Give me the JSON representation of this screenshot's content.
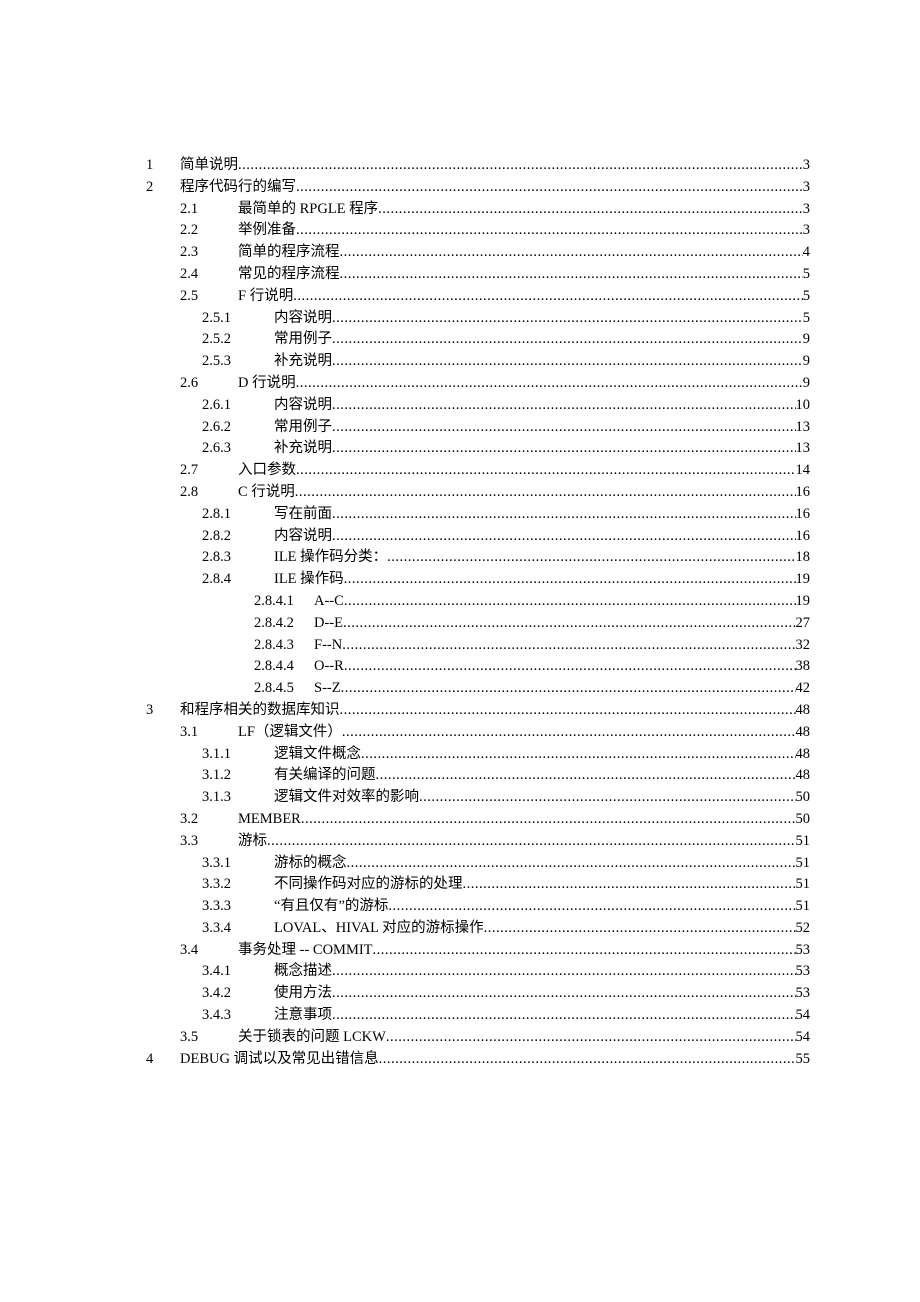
{
  "toc": [
    {
      "level": 1,
      "num": "1",
      "title": "简单说明",
      "page": "3"
    },
    {
      "level": 1,
      "num": "2",
      "title": "程序代码行的编写",
      "page": "3"
    },
    {
      "level": 2,
      "num": "2.1",
      "title": "最简单的 RPGLE 程序",
      "page": "3"
    },
    {
      "level": 2,
      "num": "2.2",
      "title": "举例准备",
      "page": "3"
    },
    {
      "level": 2,
      "num": "2.3",
      "title": "简单的程序流程",
      "page": "4"
    },
    {
      "level": 2,
      "num": "2.4",
      "title": "常见的程序流程",
      "page": "5"
    },
    {
      "level": 2,
      "num": "2.5",
      "title": "F 行说明 ",
      "page": "5"
    },
    {
      "level": 3,
      "num": "2.5.1",
      "title": "内容说明",
      "page": "5"
    },
    {
      "level": 3,
      "num": "2.5.2",
      "title": "常用例子",
      "page": "9"
    },
    {
      "level": 3,
      "num": "2.5.3",
      "title": "补充说明",
      "page": "9"
    },
    {
      "level": 2,
      "num": "2.6",
      "title": "D 行说明",
      "page": "9"
    },
    {
      "level": 3,
      "num": "2.6.1",
      "title": "内容说明",
      "page": "10"
    },
    {
      "level": 3,
      "num": "2.6.2",
      "title": "常用例子",
      "page": "13"
    },
    {
      "level": 3,
      "num": "2.6.3",
      "title": "补充说明",
      "page": "13"
    },
    {
      "level": 2,
      "num": "2.7",
      "title": "入口参数",
      "page": "14"
    },
    {
      "level": 2,
      "num": "2.8",
      "title": "C 行说明",
      "page": "16"
    },
    {
      "level": 3,
      "num": "2.8.1",
      "title": "写在前面",
      "page": "16"
    },
    {
      "level": 3,
      "num": "2.8.2",
      "title": "内容说明",
      "page": "16"
    },
    {
      "level": 3,
      "num": "2.8.3",
      "title": "ILE 操作码分类： ",
      "page": "18"
    },
    {
      "level": 3,
      "num": "2.8.4",
      "title": "ILE 操作码 ",
      "page": "19"
    },
    {
      "level": 4,
      "num": "2.8.4.1",
      "title": "A--C ",
      "page": "19"
    },
    {
      "level": 4,
      "num": "2.8.4.2",
      "title": "D--E",
      "page": "27"
    },
    {
      "level": 4,
      "num": "2.8.4.3",
      "title": "F--N",
      "page": "32"
    },
    {
      "level": 4,
      "num": "2.8.4.4",
      "title": "O--R ",
      "page": "38"
    },
    {
      "level": 4,
      "num": "2.8.4.5",
      "title": "S--Z ",
      "page": "42"
    },
    {
      "level": 1,
      "num": "3",
      "title": "和程序相关的数据库知识",
      "page": "48"
    },
    {
      "level": 2,
      "num": "3.1",
      "title": "LF（逻辑文件）",
      "page": "48"
    },
    {
      "level": 3,
      "num": "3.1.1",
      "title": "逻辑文件概念",
      "page": "48"
    },
    {
      "level": 3,
      "num": "3.1.2",
      "title": "有关编译的问题",
      "page": "48"
    },
    {
      "level": 3,
      "num": "3.1.3",
      "title": "逻辑文件对效率的影响",
      "page": "50"
    },
    {
      "level": 2,
      "num": "3.2",
      "title": "MEMBER",
      "page": "50"
    },
    {
      "level": 2,
      "num": "3.3",
      "title": "游标",
      "page": "51"
    },
    {
      "level": 3,
      "num": "3.3.1",
      "title": "游标的概念",
      "page": "51"
    },
    {
      "level": 3,
      "num": "3.3.2",
      "title": "不同操作码对应的游标的处理",
      "page": "51"
    },
    {
      "level": 3,
      "num": "3.3.3",
      "title": "“有且仅有”的游标",
      "page": "51"
    },
    {
      "level": 3,
      "num": "3.3.4",
      "title": "LOVAL、HIVAL 对应的游标操作",
      "page": "52"
    },
    {
      "level": 2,
      "num": "3.4",
      "title": "事务处理  -- COMMIT ",
      "page": "53"
    },
    {
      "level": 3,
      "num": "3.4.1",
      "title": "概念描述",
      "page": "53"
    },
    {
      "level": 3,
      "num": "3.4.2",
      "title": "使用方法",
      "page": "53"
    },
    {
      "level": 3,
      "num": "3.4.3",
      "title": "注意事项",
      "page": "54"
    },
    {
      "level": 2,
      "num": "3.5",
      "title": "关于锁表的问题 LCKW",
      "page": "54"
    },
    {
      "level": 1,
      "num": "4",
      "title": "DEBUG 调试以及常见出错信息",
      "page": "55"
    }
  ]
}
